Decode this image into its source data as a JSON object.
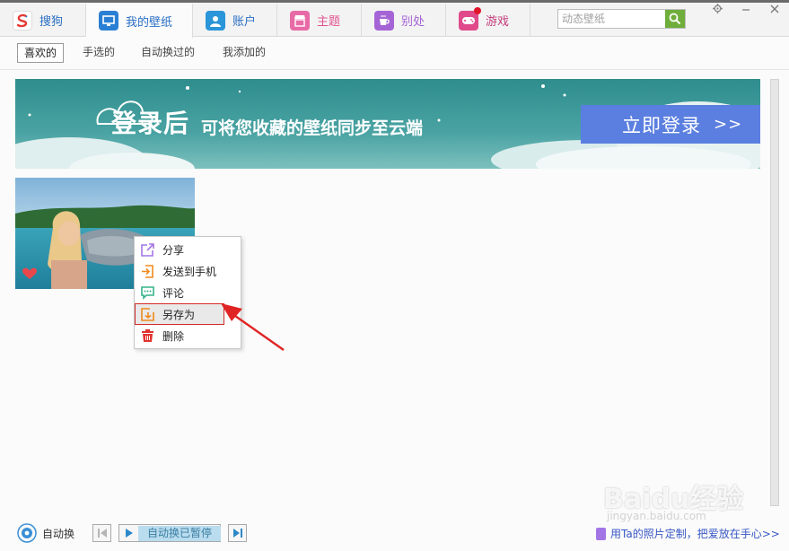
{
  "tabs": [
    {
      "label": "搜狗",
      "icon": "sogou-logo-icon",
      "color": "#e53935"
    },
    {
      "label": "我的壁纸",
      "icon": "monitor-icon",
      "color": "#2a7fd4"
    },
    {
      "label": "账户",
      "icon": "user-icon",
      "color": "#2a95d8"
    },
    {
      "label": "主题",
      "icon": "store-icon",
      "color": "#e86aa6"
    },
    {
      "label": "别处",
      "icon": "cup-icon",
      "color": "#a564d6"
    },
    {
      "label": "游戏",
      "icon": "gamepad-icon",
      "color": "#e04a8a"
    }
  ],
  "search": {
    "placeholder": "动态壁纸"
  },
  "subtabs": [
    "喜欢的",
    "手选的",
    "自动换过的",
    "我添加的"
  ],
  "banner": {
    "headline": "登录后",
    "subline": "可将您收藏的壁纸同步至云端",
    "login": "立即登录",
    "login_arrow": ">>"
  },
  "context_menu": [
    {
      "label": "分享",
      "icon": "share-icon",
      "color": "#a376e6"
    },
    {
      "label": "发送到手机",
      "icon": "send-to-phone-icon",
      "color": "#f08a1c"
    },
    {
      "label": "评论",
      "icon": "comment-icon",
      "color": "#36b48a"
    },
    {
      "label": "另存为",
      "icon": "save-as-icon",
      "color": "#f08a1c"
    },
    {
      "label": "删除",
      "icon": "trash-icon",
      "color": "#e0332f"
    }
  ],
  "bottom": {
    "auto_label": "自动换",
    "status": "自动换已暂停",
    "promo": "用Ta的照片定制，把爱放在手心>>"
  },
  "watermark": {
    "text": "Baidu经验",
    "sub": "jingyan.baidu.com"
  }
}
